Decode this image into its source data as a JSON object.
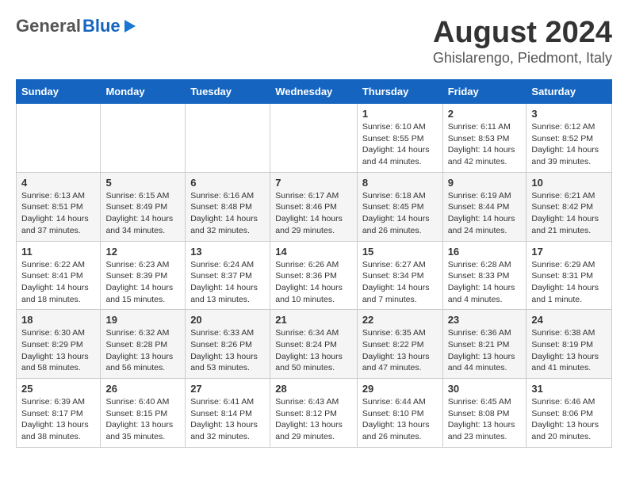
{
  "header": {
    "logo_general": "General",
    "logo_blue": "Blue",
    "month": "August 2024",
    "location": "Ghislarengo, Piedmont, Italy"
  },
  "days_of_week": [
    "Sunday",
    "Monday",
    "Tuesday",
    "Wednesday",
    "Thursday",
    "Friday",
    "Saturday"
  ],
  "weeks": [
    {
      "days": [
        {
          "number": "",
          "info": ""
        },
        {
          "number": "",
          "info": ""
        },
        {
          "number": "",
          "info": ""
        },
        {
          "number": "",
          "info": ""
        },
        {
          "number": "1",
          "info": "Sunrise: 6:10 AM\nSunset: 8:55 PM\nDaylight: 14 hours and 44 minutes."
        },
        {
          "number": "2",
          "info": "Sunrise: 6:11 AM\nSunset: 8:53 PM\nDaylight: 14 hours and 42 minutes."
        },
        {
          "number": "3",
          "info": "Sunrise: 6:12 AM\nSunset: 8:52 PM\nDaylight: 14 hours and 39 minutes."
        }
      ]
    },
    {
      "days": [
        {
          "number": "4",
          "info": "Sunrise: 6:13 AM\nSunset: 8:51 PM\nDaylight: 14 hours and 37 minutes."
        },
        {
          "number": "5",
          "info": "Sunrise: 6:15 AM\nSunset: 8:49 PM\nDaylight: 14 hours and 34 minutes."
        },
        {
          "number": "6",
          "info": "Sunrise: 6:16 AM\nSunset: 8:48 PM\nDaylight: 14 hours and 32 minutes."
        },
        {
          "number": "7",
          "info": "Sunrise: 6:17 AM\nSunset: 8:46 PM\nDaylight: 14 hours and 29 minutes."
        },
        {
          "number": "8",
          "info": "Sunrise: 6:18 AM\nSunset: 8:45 PM\nDaylight: 14 hours and 26 minutes."
        },
        {
          "number": "9",
          "info": "Sunrise: 6:19 AM\nSunset: 8:44 PM\nDaylight: 14 hours and 24 minutes."
        },
        {
          "number": "10",
          "info": "Sunrise: 6:21 AM\nSunset: 8:42 PM\nDaylight: 14 hours and 21 minutes."
        }
      ]
    },
    {
      "days": [
        {
          "number": "11",
          "info": "Sunrise: 6:22 AM\nSunset: 8:41 PM\nDaylight: 14 hours and 18 minutes."
        },
        {
          "number": "12",
          "info": "Sunrise: 6:23 AM\nSunset: 8:39 PM\nDaylight: 14 hours and 15 minutes."
        },
        {
          "number": "13",
          "info": "Sunrise: 6:24 AM\nSunset: 8:37 PM\nDaylight: 14 hours and 13 minutes."
        },
        {
          "number": "14",
          "info": "Sunrise: 6:26 AM\nSunset: 8:36 PM\nDaylight: 14 hours and 10 minutes."
        },
        {
          "number": "15",
          "info": "Sunrise: 6:27 AM\nSunset: 8:34 PM\nDaylight: 14 hours and 7 minutes."
        },
        {
          "number": "16",
          "info": "Sunrise: 6:28 AM\nSunset: 8:33 PM\nDaylight: 14 hours and 4 minutes."
        },
        {
          "number": "17",
          "info": "Sunrise: 6:29 AM\nSunset: 8:31 PM\nDaylight: 14 hours and 1 minute."
        }
      ]
    },
    {
      "days": [
        {
          "number": "18",
          "info": "Sunrise: 6:30 AM\nSunset: 8:29 PM\nDaylight: 13 hours and 58 minutes."
        },
        {
          "number": "19",
          "info": "Sunrise: 6:32 AM\nSunset: 8:28 PM\nDaylight: 13 hours and 56 minutes."
        },
        {
          "number": "20",
          "info": "Sunrise: 6:33 AM\nSunset: 8:26 PM\nDaylight: 13 hours and 53 minutes."
        },
        {
          "number": "21",
          "info": "Sunrise: 6:34 AM\nSunset: 8:24 PM\nDaylight: 13 hours and 50 minutes."
        },
        {
          "number": "22",
          "info": "Sunrise: 6:35 AM\nSunset: 8:22 PM\nDaylight: 13 hours and 47 minutes."
        },
        {
          "number": "23",
          "info": "Sunrise: 6:36 AM\nSunset: 8:21 PM\nDaylight: 13 hours and 44 minutes."
        },
        {
          "number": "24",
          "info": "Sunrise: 6:38 AM\nSunset: 8:19 PM\nDaylight: 13 hours and 41 minutes."
        }
      ]
    },
    {
      "days": [
        {
          "number": "25",
          "info": "Sunrise: 6:39 AM\nSunset: 8:17 PM\nDaylight: 13 hours and 38 minutes."
        },
        {
          "number": "26",
          "info": "Sunrise: 6:40 AM\nSunset: 8:15 PM\nDaylight: 13 hours and 35 minutes."
        },
        {
          "number": "27",
          "info": "Sunrise: 6:41 AM\nSunset: 8:14 PM\nDaylight: 13 hours and 32 minutes."
        },
        {
          "number": "28",
          "info": "Sunrise: 6:43 AM\nSunset: 8:12 PM\nDaylight: 13 hours and 29 minutes."
        },
        {
          "number": "29",
          "info": "Sunrise: 6:44 AM\nSunset: 8:10 PM\nDaylight: 13 hours and 26 minutes."
        },
        {
          "number": "30",
          "info": "Sunrise: 6:45 AM\nSunset: 8:08 PM\nDaylight: 13 hours and 23 minutes."
        },
        {
          "number": "31",
          "info": "Sunrise: 6:46 AM\nSunset: 8:06 PM\nDaylight: 13 hours and 20 minutes."
        }
      ]
    }
  ]
}
